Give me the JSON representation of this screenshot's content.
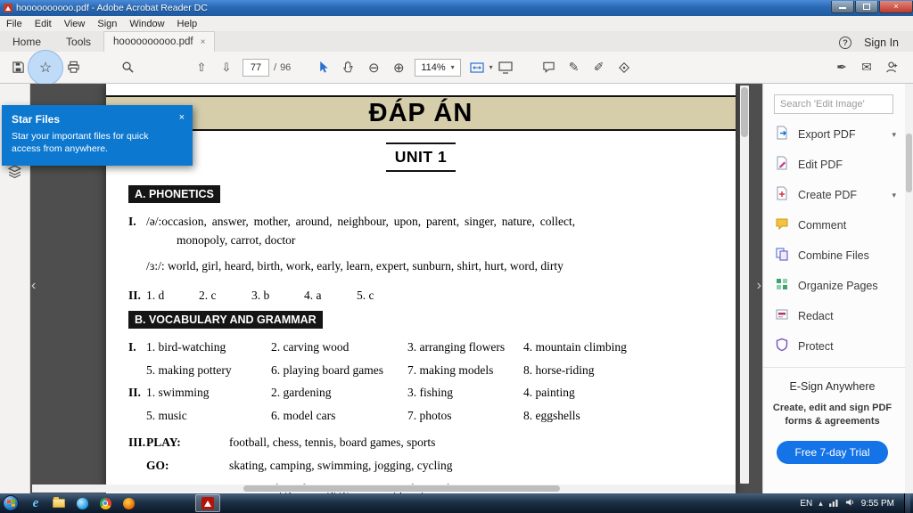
{
  "window": {
    "title": "hoooooooooo.pdf - Adobe Acrobat Reader DC"
  },
  "menu": {
    "items": [
      "File",
      "Edit",
      "View",
      "Sign",
      "Window",
      "Help"
    ]
  },
  "tabs": {
    "home": "Home",
    "tools": "Tools",
    "document": "hoooooooooo.pdf",
    "sign_in": "Sign In"
  },
  "toolbar": {
    "page_current": "77",
    "page_sep": "/",
    "page_total": "96",
    "zoom": "114%"
  },
  "icons": {
    "star": "☆",
    "close": "×",
    "chevron_down": "▾",
    "help": "?",
    "page_up": "⇧",
    "page_down": "⇩",
    "zoom_out": "⊖",
    "zoom_in": "⊕",
    "highlight_pen": "✎",
    "draw_pen": "✐",
    "fill_sign_pen": "✒",
    "envelope": "✉",
    "collapse_left": "‹",
    "collapse_right": "›",
    "tray_up": "▴",
    "ie_e": "e"
  },
  "star_tooltip": {
    "title": "Star Files",
    "body": "Star your important files for quick access from anywhere."
  },
  "document": {
    "title": "ĐÁP ÁN",
    "unit": "UNIT 1",
    "section_a": {
      "heading": "A. PHONETICS",
      "i_label": "I.",
      "line1a": "/ə/:occasion, answer, mother, around, neighbour, upon, parent, singer, nature, collect,",
      "line1b": "monopoly, carrot, doctor",
      "line2": "/ɜ:/: world, girl, heard, birth, work, early, learn, expert, sunburn, shirt, hurt, word, dirty",
      "ii_label": "II.",
      "answers": [
        "1. d",
        "2. c",
        "3. b",
        "4. a",
        "5. c"
      ]
    },
    "section_b": {
      "heading": "B. VOCABULARY AND GRAMMAR",
      "i_label": "I.",
      "i_row1": [
        "1. bird-watching",
        "2. carving wood",
        "3. arranging flowers",
        "4. mountain climbing"
      ],
      "i_row2": [
        "5. making pottery",
        "6. playing board games",
        "7. making models",
        "8. horse-riding"
      ],
      "ii_label": "II.",
      "ii_row1": [
        "1. swimming",
        "2. gardening",
        "3. fishing",
        "4. painting"
      ],
      "ii_row2": [
        "5. music",
        "6. model cars",
        "7. photos",
        "8. eggshells"
      ],
      "iii_label": "III.",
      "verbs": [
        {
          "verb": "PLAY:",
          "items": "football, chess, tennis, board games, sports"
        },
        {
          "verb": "GO:",
          "items": "skating, camping, swimming, jogging, cycling"
        },
        {
          "verb": "DO:",
          "items": "crossword, gardening, gymnastics, judo, aerobics"
        }
      ]
    }
  },
  "right_panel": {
    "search_placeholder": "Search 'Edit Image'",
    "tools": [
      {
        "label": "Export PDF",
        "icon": "export-pdf-icon",
        "has_chevron": true
      },
      {
        "label": "Edit PDF",
        "icon": "edit-pdf-icon",
        "has_chevron": false
      },
      {
        "label": "Create PDF",
        "icon": "create-pdf-icon",
        "has_chevron": true
      },
      {
        "label": "Comment",
        "icon": "comment-icon",
        "has_chevron": false
      },
      {
        "label": "Combine Files",
        "icon": "combine-files-icon",
        "has_chevron": false
      },
      {
        "label": "Organize Pages",
        "icon": "organize-pages-icon",
        "has_chevron": false
      },
      {
        "label": "Redact",
        "icon": "redact-icon",
        "has_chevron": false
      },
      {
        "label": "Protect",
        "icon": "protect-icon",
        "has_chevron": false
      }
    ],
    "promo": {
      "title": "E-Sign Anywhere",
      "subtitle": "Create, edit and sign PDF forms & agreements",
      "button": "Free 7-day Trial"
    }
  },
  "taskbar": {
    "tray_language": "EN",
    "time": "9:55 PM"
  }
}
